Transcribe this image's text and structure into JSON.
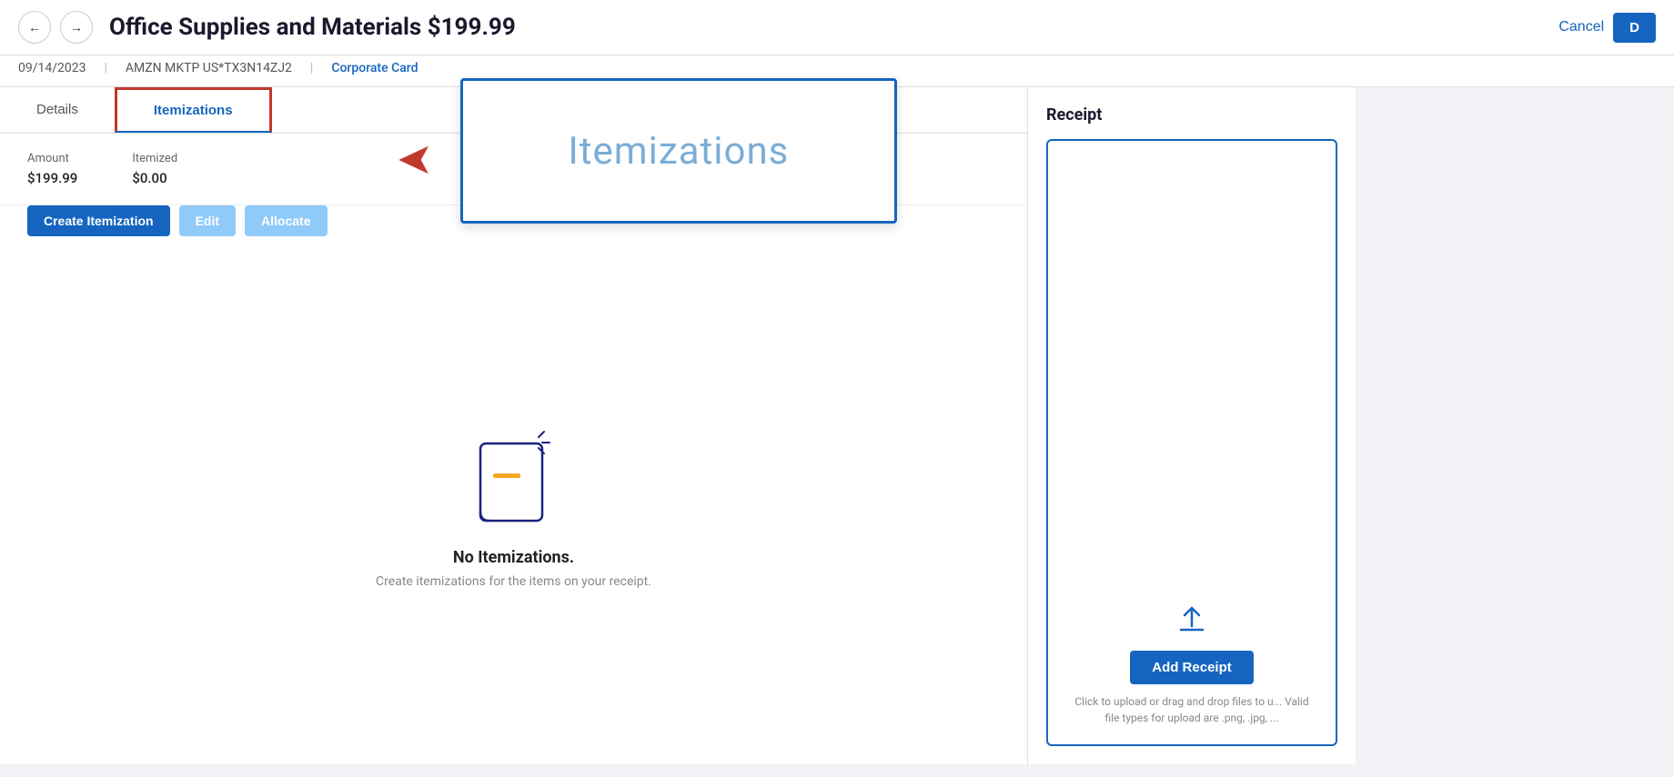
{
  "header": {
    "title": "Office Supplies and Materials $199.99",
    "cancel_label": "Cancel",
    "done_label": "D",
    "nav_back": "←",
    "nav_forward": "→"
  },
  "meta": {
    "date": "09/14/2023",
    "ref": "AMZN MKTP US*TX3N14ZJ2",
    "card_label": "Corporate Card"
  },
  "tabs": {
    "details_label": "Details",
    "itemizations_label": "Itemizations"
  },
  "amounts": {
    "amount_label": "Amount",
    "amount_value": "$199.99",
    "itemized_label": "Itemized",
    "itemized_value": "$0.00"
  },
  "buttons": {
    "create_itemization": "Create Itemization",
    "edit": "Edit",
    "allocate": "Allocate",
    "add_receipt": "Add Receipt"
  },
  "empty_state": {
    "title": "No Itemizations.",
    "subtitle": "Create itemizations for the items on your receipt."
  },
  "receipt": {
    "section_title": "Receipt",
    "upload_hint": "Click to upload or drag and drop files to u...\nValid file types for upload are .png, .jpg, ..."
  },
  "popup": {
    "label": "Itemizations"
  }
}
